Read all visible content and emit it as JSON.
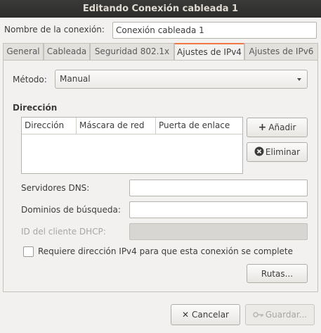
{
  "window": {
    "title": "Editando Conexión cableada 1"
  },
  "connection_name": {
    "label": "Nombre de la conexión:",
    "value": "Conexión cableada 1"
  },
  "tabs": [
    {
      "label": "General"
    },
    {
      "label": "Cableada"
    },
    {
      "label": "Seguridad 802.1x"
    },
    {
      "label": "Ajustes de IPv4"
    },
    {
      "label": "Ajustes de IPv6"
    }
  ],
  "ipv4": {
    "method_label": "Método:",
    "method_value": "Manual",
    "address_section": "Dirección",
    "columns": [
      "Dirección",
      "Máscara de red",
      "Puerta de enlace"
    ],
    "add_label": "Añadir",
    "delete_label": "Eliminar",
    "dns_label": "Servidores DNS:",
    "dns_value": "",
    "search_domains_label": "Dominios de búsqueda:",
    "search_domains_value": "",
    "dhcp_client_id_label": "ID del cliente DHCP:",
    "dhcp_client_id_value": "",
    "require_ipv4_label": "Requiere dirección IPv4 para que esta conexión se complete",
    "require_ipv4_checked": false,
    "routes_label": "Rutas..."
  },
  "footer": {
    "cancel_label": "Cancelar",
    "save_label": "Guardar..."
  },
  "colors": {
    "accent": "#f07746",
    "titlebar": "#2c2c2a"
  }
}
